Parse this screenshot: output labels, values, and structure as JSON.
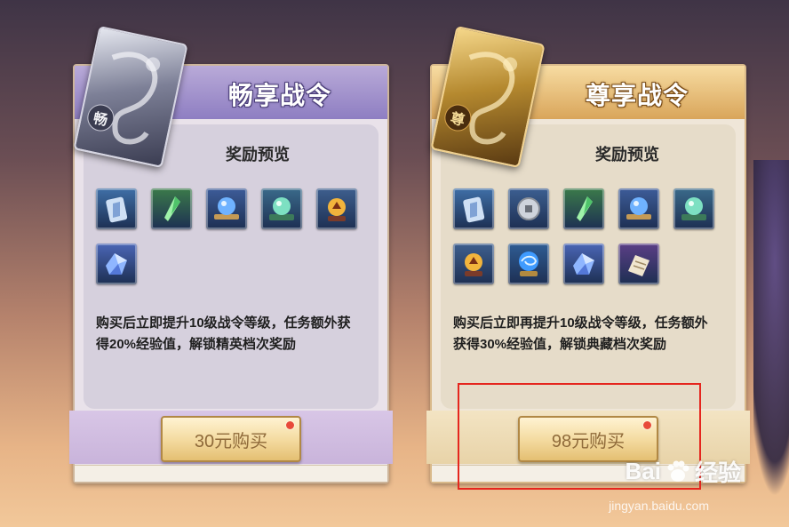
{
  "cards": [
    {
      "id": "left",
      "title": "畅享战令",
      "emblem_char": "畅",
      "preview_label": "奖励预览",
      "items": [
        {
          "icon": "token-card-icon",
          "bg": "#3f6fa7"
        },
        {
          "icon": "green-crystal-icon",
          "bg": "#3b7a4a"
        },
        {
          "icon": "blue-orb-scroll-icon",
          "bg": "#3d5c99"
        },
        {
          "icon": "green-orb-book-icon",
          "bg": "#3a6a8a"
        },
        {
          "icon": "golden-orb-icon",
          "bg": "#3e5f8e"
        },
        {
          "icon": "blue-shard-icon",
          "bg": "#4b66b6"
        }
      ],
      "description": "购买后立即提升10级战令等级，任务额外获得20%经验值，解锁精英档次奖励",
      "buy_label": "30元购买"
    },
    {
      "id": "right",
      "title": "尊享战令",
      "emblem_char": "尊",
      "preview_label": "奖励预览",
      "items": [
        {
          "icon": "token-card-icon",
          "bg": "#3f6fa7"
        },
        {
          "icon": "silver-coin-icon",
          "bg": "#3c5f91"
        },
        {
          "icon": "green-crystal-icon",
          "bg": "#3b7a4a"
        },
        {
          "icon": "blue-orb-scroll-icon",
          "bg": "#3d5c99"
        },
        {
          "icon": "green-orb-book-icon",
          "bg": "#3a6a8a"
        },
        {
          "icon": "golden-orb-icon",
          "bg": "#3e5f8e"
        },
        {
          "icon": "blue-swirl-orb-icon",
          "bg": "#2f5d94"
        },
        {
          "icon": "blue-shard-icon",
          "bg": "#4b66b6"
        },
        {
          "icon": "scroll-paper-icon",
          "bg": "#5b3f86"
        }
      ],
      "description": "购买后立即再提升10级战令等级，任务额外获得30%经验值，解锁典藏档次奖励",
      "buy_label": "98元购买"
    }
  ],
  "watermark": {
    "brand_left": "Bai",
    "brand_right": "经验",
    "url": "jingyan.baidu.com"
  },
  "colors": {
    "highlight": "#e5261e",
    "buy_text": "#8f6a3a"
  }
}
